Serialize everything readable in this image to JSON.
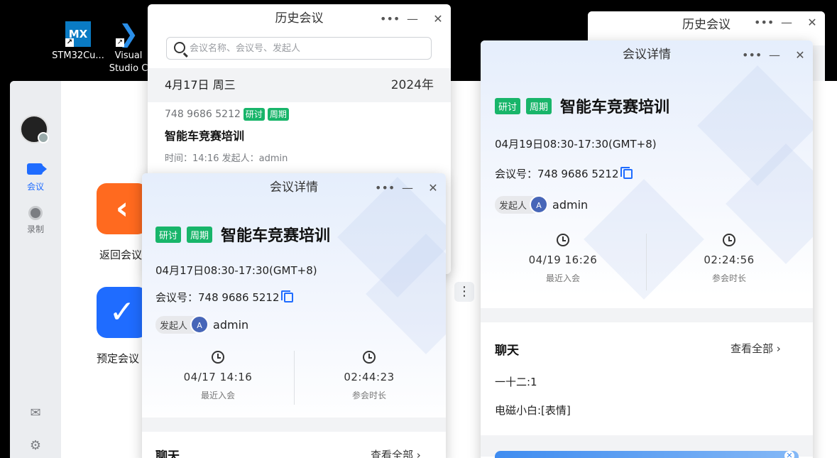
{
  "desktop": {
    "icons": [
      {
        "label": "STM32Cu...",
        "glyph": "MX"
      },
      {
        "label": "Visual Studio C",
        "glyph": "VS"
      }
    ]
  },
  "app": {
    "sidebar": {
      "meeting_label": "会议",
      "record_label": "录制"
    },
    "actions": {
      "return_label": "返回会议",
      "schedule_label": "预定会议"
    }
  },
  "history_back": {
    "title": "历史会议"
  },
  "history": {
    "title": "历史会议",
    "search_placeholder": "会议名称、会议号、发起人",
    "date": "4月17日 周三",
    "year": "2024年",
    "item": {
      "id": "748 9686 5212",
      "tags": [
        "研讨",
        "周期"
      ],
      "title": "智能车竞赛培训",
      "meta": "时间：14:16  发起人：admin"
    }
  },
  "detail_left": {
    "title": "会议详情",
    "tags": [
      "研讨",
      "周期"
    ],
    "meeting_title": "智能车竞赛培训",
    "time": "04月17日08:30-17:30(GMT+8)",
    "meeting_no": "会议号：748 9686 5212",
    "host_label": "发起人",
    "host_avatar": "A",
    "host_name": "admin",
    "last_join_value": "04/17 14:16",
    "last_join_label": "最近入会",
    "duration_value": "02:44:23",
    "duration_label": "参会时长",
    "chat_title": "聊天",
    "chat_all": "查看全部"
  },
  "detail_right": {
    "title": "会议详情",
    "tags": [
      "研讨",
      "周期"
    ],
    "meeting_title": "智能车竞赛培训",
    "time": "04月19日08:30-17:30(GMT+8)",
    "meeting_no": "会议号：748 9686 5212",
    "host_label": "发起人",
    "host_avatar": "A",
    "host_name": "admin",
    "last_join_value": "04/19 16:26",
    "last_join_label": "最近入会",
    "duration_value": "02:24:56",
    "duration_label": "参会时长",
    "chat_title": "聊天",
    "chat_all": "查看全部",
    "messages": [
      "一十二:1",
      "电磁小白:[表情]"
    ]
  },
  "colors": {
    "accent": "#1f6cff",
    "tag_green": "#18b56a",
    "orange": "#ff6a1f"
  }
}
